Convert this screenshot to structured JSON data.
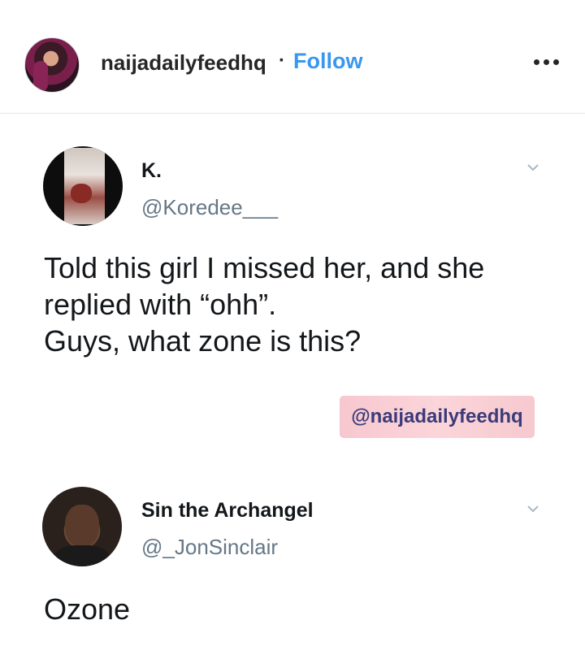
{
  "post": {
    "username": "naijadailyfeedhq",
    "separator": "·",
    "follow_label": "Follow",
    "accent_color": "#3897f0"
  },
  "tweets": [
    {
      "name": "K.",
      "handle": "@Koredee___",
      "text": "Told this girl I missed her, and she\nreplied with “ohh”.\nGuys, what zone is this?"
    },
    {
      "name": "Sin the Archangel",
      "handle": "@_JonSinclair",
      "text": "Ozone"
    }
  ],
  "watermark": "@naijadailyfeedhq",
  "icons": [
    "more-options-icon",
    "chevron-down-icon"
  ]
}
